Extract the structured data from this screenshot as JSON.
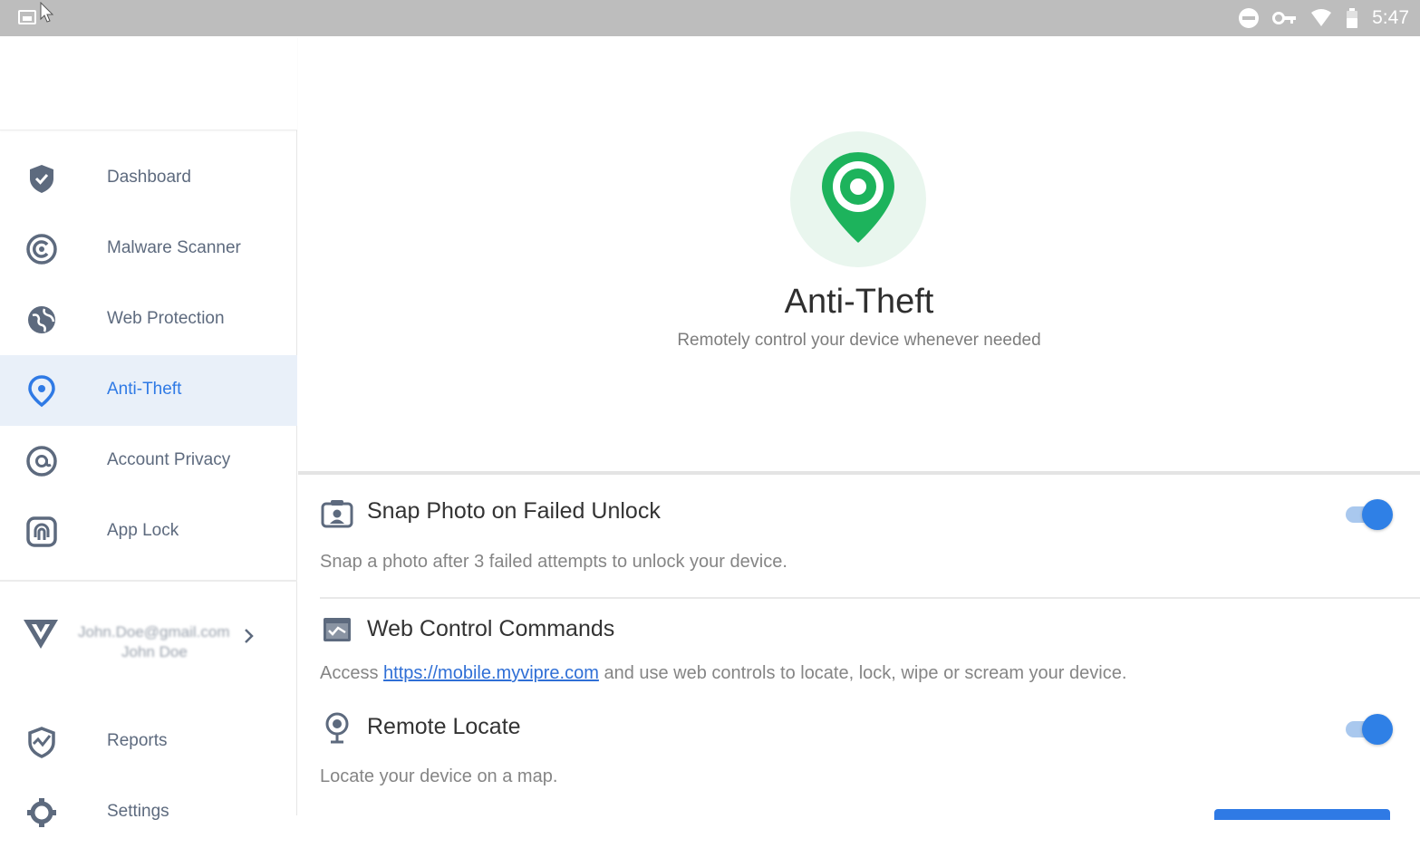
{
  "status_bar": {
    "time": "5:47",
    "icons": [
      "image-icon",
      "do-not-disturb-icon",
      "vpn-key-icon",
      "wifi-icon",
      "battery-icon"
    ]
  },
  "sidebar": {
    "items": [
      {
        "label": "Dashboard",
        "icon": "shield-check-icon"
      },
      {
        "label": "Malware Scanner",
        "icon": "scan-icon"
      },
      {
        "label": "Web Protection",
        "icon": "globe-icon"
      },
      {
        "label": "Anti-Theft",
        "icon": "location-pin-icon",
        "active": true
      },
      {
        "label": "Account Privacy",
        "icon": "at-sign-icon"
      },
      {
        "label": "App Lock",
        "icon": "fingerprint-lock-icon"
      }
    ],
    "account": {
      "email": "John.Doe@gmail.com",
      "name": "John Doe"
    },
    "bottom_items": [
      {
        "label": "Reports",
        "icon": "reports-icon"
      },
      {
        "label": "Settings",
        "icon": "gear-icon"
      }
    ]
  },
  "hero": {
    "title": "Anti-Theft",
    "subtitle": "Remotely control your device whenever needed",
    "icon": "location-pin-icon"
  },
  "settings": [
    {
      "title": "Snap Photo on Failed Unlock",
      "description": "Snap a photo after 3 failed attempts to unlock your device.",
      "icon": "camera-icon",
      "enabled": true
    },
    {
      "title": "Web Control Commands",
      "description_prefix": "Access ",
      "link": "https://mobile.myvipre.com",
      "description_suffix": " and use web controls to locate, lock, wipe or scream your device.",
      "icon": "web-control-icon"
    },
    {
      "title": "Remote Locate",
      "description": "Locate your device on a map.",
      "icon": "locate-icon",
      "enabled": true
    }
  ],
  "colors": {
    "accent": "#2f7ae5",
    "pin_green": "#1db35c",
    "active_bg": "#e9f0f9"
  }
}
